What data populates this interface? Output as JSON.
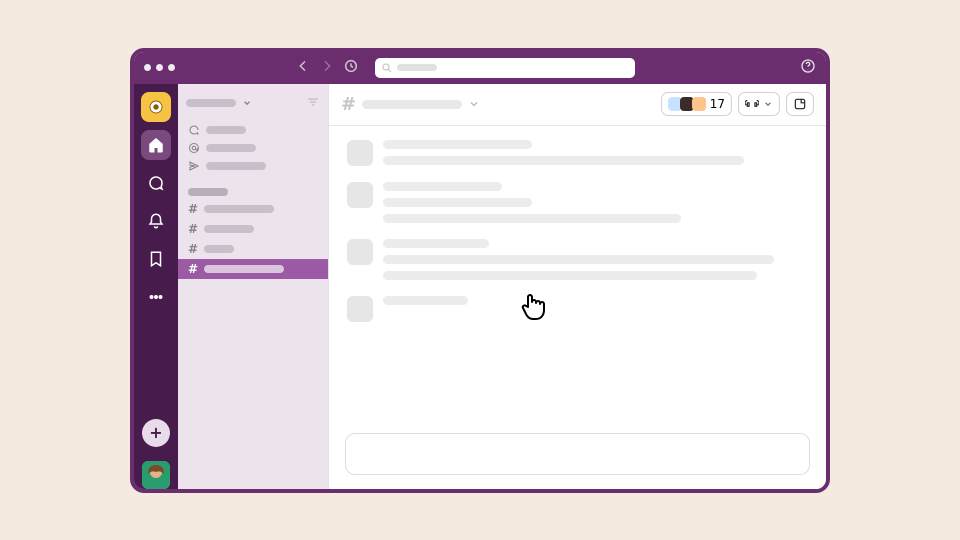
{
  "header": {
    "members_count": "17"
  },
  "channel": {
    "hash_symbol": "#"
  },
  "sidebar": {
    "channels": [
      {
        "symbol": "#"
      },
      {
        "symbol": "#"
      },
      {
        "symbol": "#"
      },
      {
        "symbol": "#"
      }
    ]
  },
  "colors": {
    "brand": "#6a2e6e",
    "rail": "#471b4b",
    "accent": "#9b5aa3",
    "workspace": "#f6c343"
  }
}
